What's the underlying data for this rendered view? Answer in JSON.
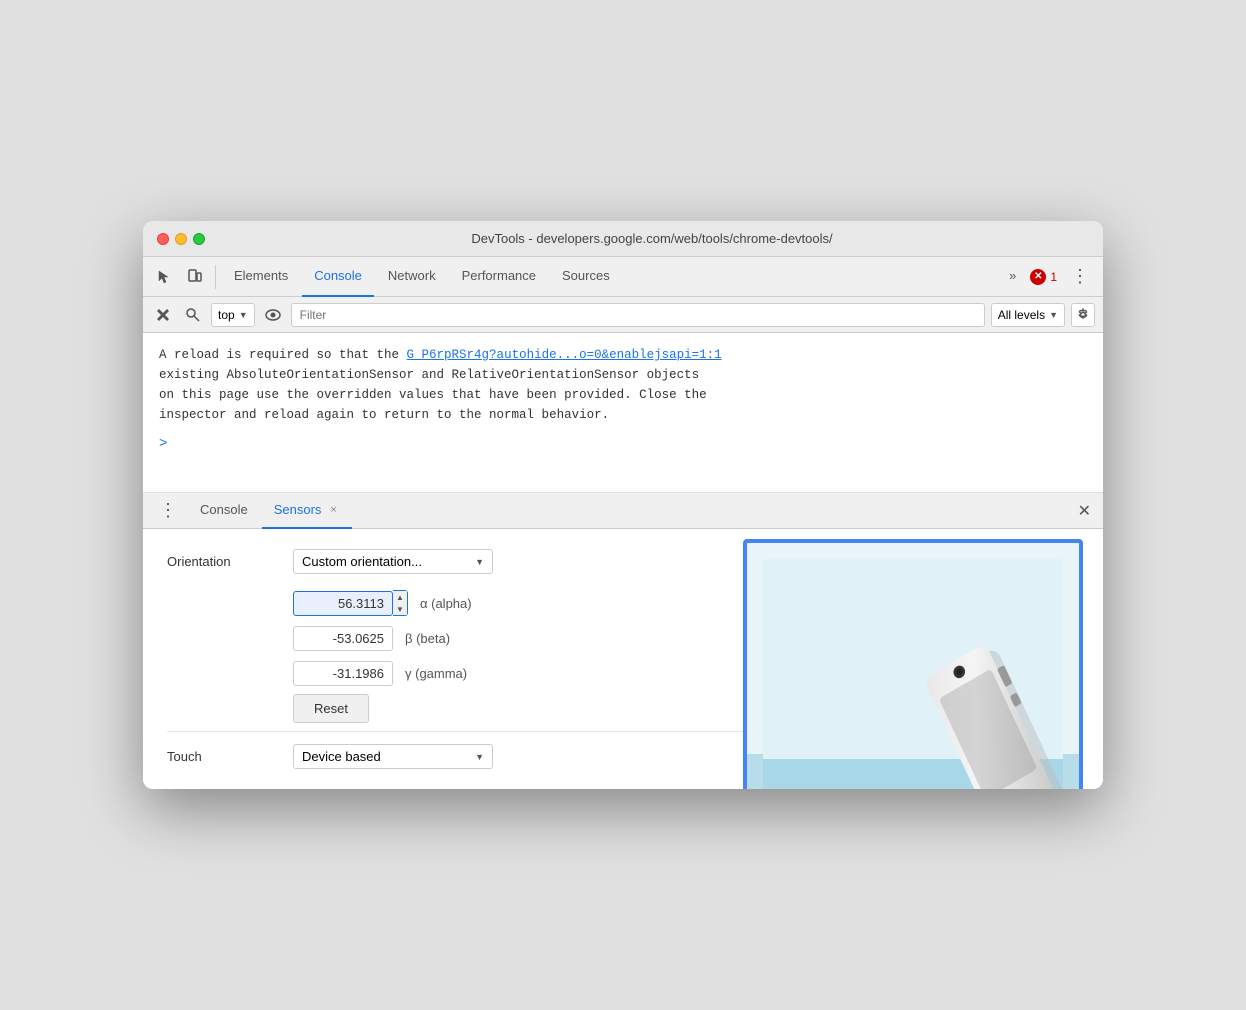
{
  "window": {
    "title": "DevTools - developers.google.com/web/tools/chrome-devtools/"
  },
  "toolbar": {
    "tabs": [
      {
        "id": "elements",
        "label": "Elements",
        "active": false
      },
      {
        "id": "console",
        "label": "Console",
        "active": true
      },
      {
        "id": "network",
        "label": "Network",
        "active": false
      },
      {
        "id": "performance",
        "label": "Performance",
        "active": false
      },
      {
        "id": "sources",
        "label": "Sources",
        "active": false
      }
    ],
    "more_label": "»",
    "error_count": "1",
    "more_options": "⋮"
  },
  "console_toolbar": {
    "context": "top",
    "filter_placeholder": "Filter",
    "levels": "All levels"
  },
  "console_output": {
    "message": "A reload is required so that the ",
    "link_text": "G_P6rpRSr4g?autohide...o=0&enablejsapi=1:1",
    "message_rest": "existing AbsoluteOrientationSensor and RelativeOrientationSensor objects\non this page use the overridden values that have been provided. Close the\ninspector and reload again to return to the normal behavior."
  },
  "bottom_panel": {
    "tabs": [
      {
        "id": "console",
        "label": "Console",
        "active": false,
        "closable": false
      },
      {
        "id": "sensors",
        "label": "Sensors",
        "active": true,
        "closable": true
      }
    ],
    "close_label": "×"
  },
  "sensors": {
    "orientation_label": "Orientation",
    "dropdown_value": "Custom orientation...",
    "alpha_value": "56.3113",
    "alpha_label": "α (alpha)",
    "beta_value": "-53.0625",
    "beta_label": "β (beta)",
    "gamma_value": "-31.1986",
    "gamma_label": "γ (gamma)",
    "reset_label": "Reset",
    "touch_label": "Touch",
    "touch_value": "Device based"
  }
}
